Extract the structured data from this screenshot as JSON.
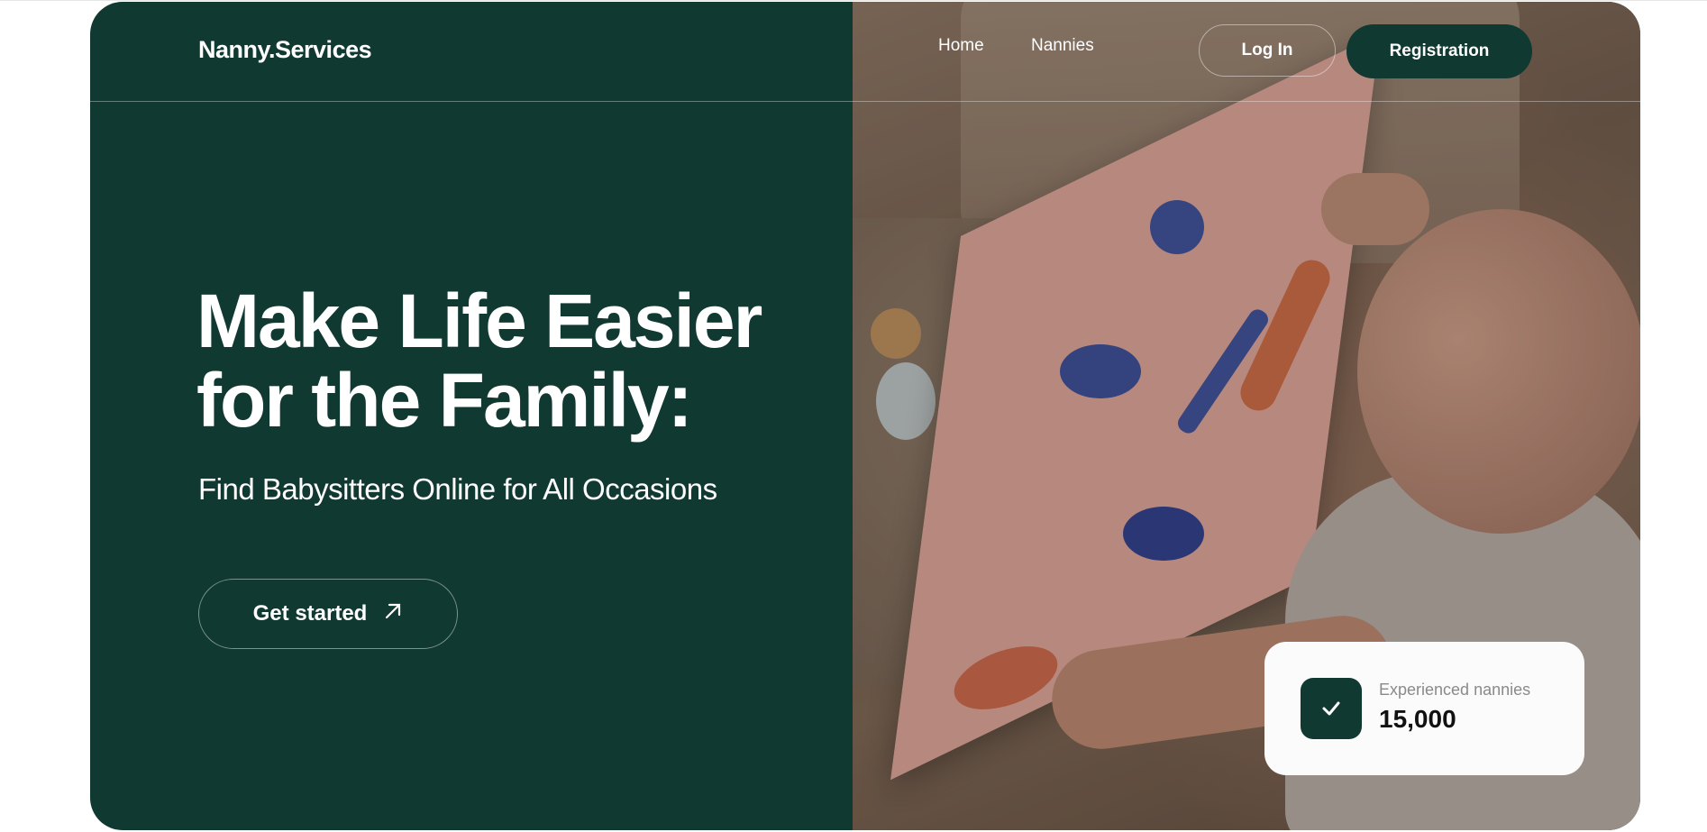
{
  "header": {
    "logo": "Nanny.Services",
    "nav": [
      {
        "label": "Home"
      },
      {
        "label": "Nannies"
      }
    ],
    "login_label": "Log In",
    "register_label": "Registration"
  },
  "hero": {
    "title": "Make Life Easier for the Family:",
    "subtitle": "Find Babysitters Online for All Occasions",
    "cta_label": "Get started",
    "cta_icon": "arrow-up-right-icon"
  },
  "stat": {
    "icon": "check-icon",
    "label": "Experienced nannies",
    "value": "15,000"
  },
  "colors": {
    "brand": "#103931",
    "text_light": "#ffffff",
    "card_bg": "#fbfbfb",
    "muted": "#8a8a8a"
  }
}
